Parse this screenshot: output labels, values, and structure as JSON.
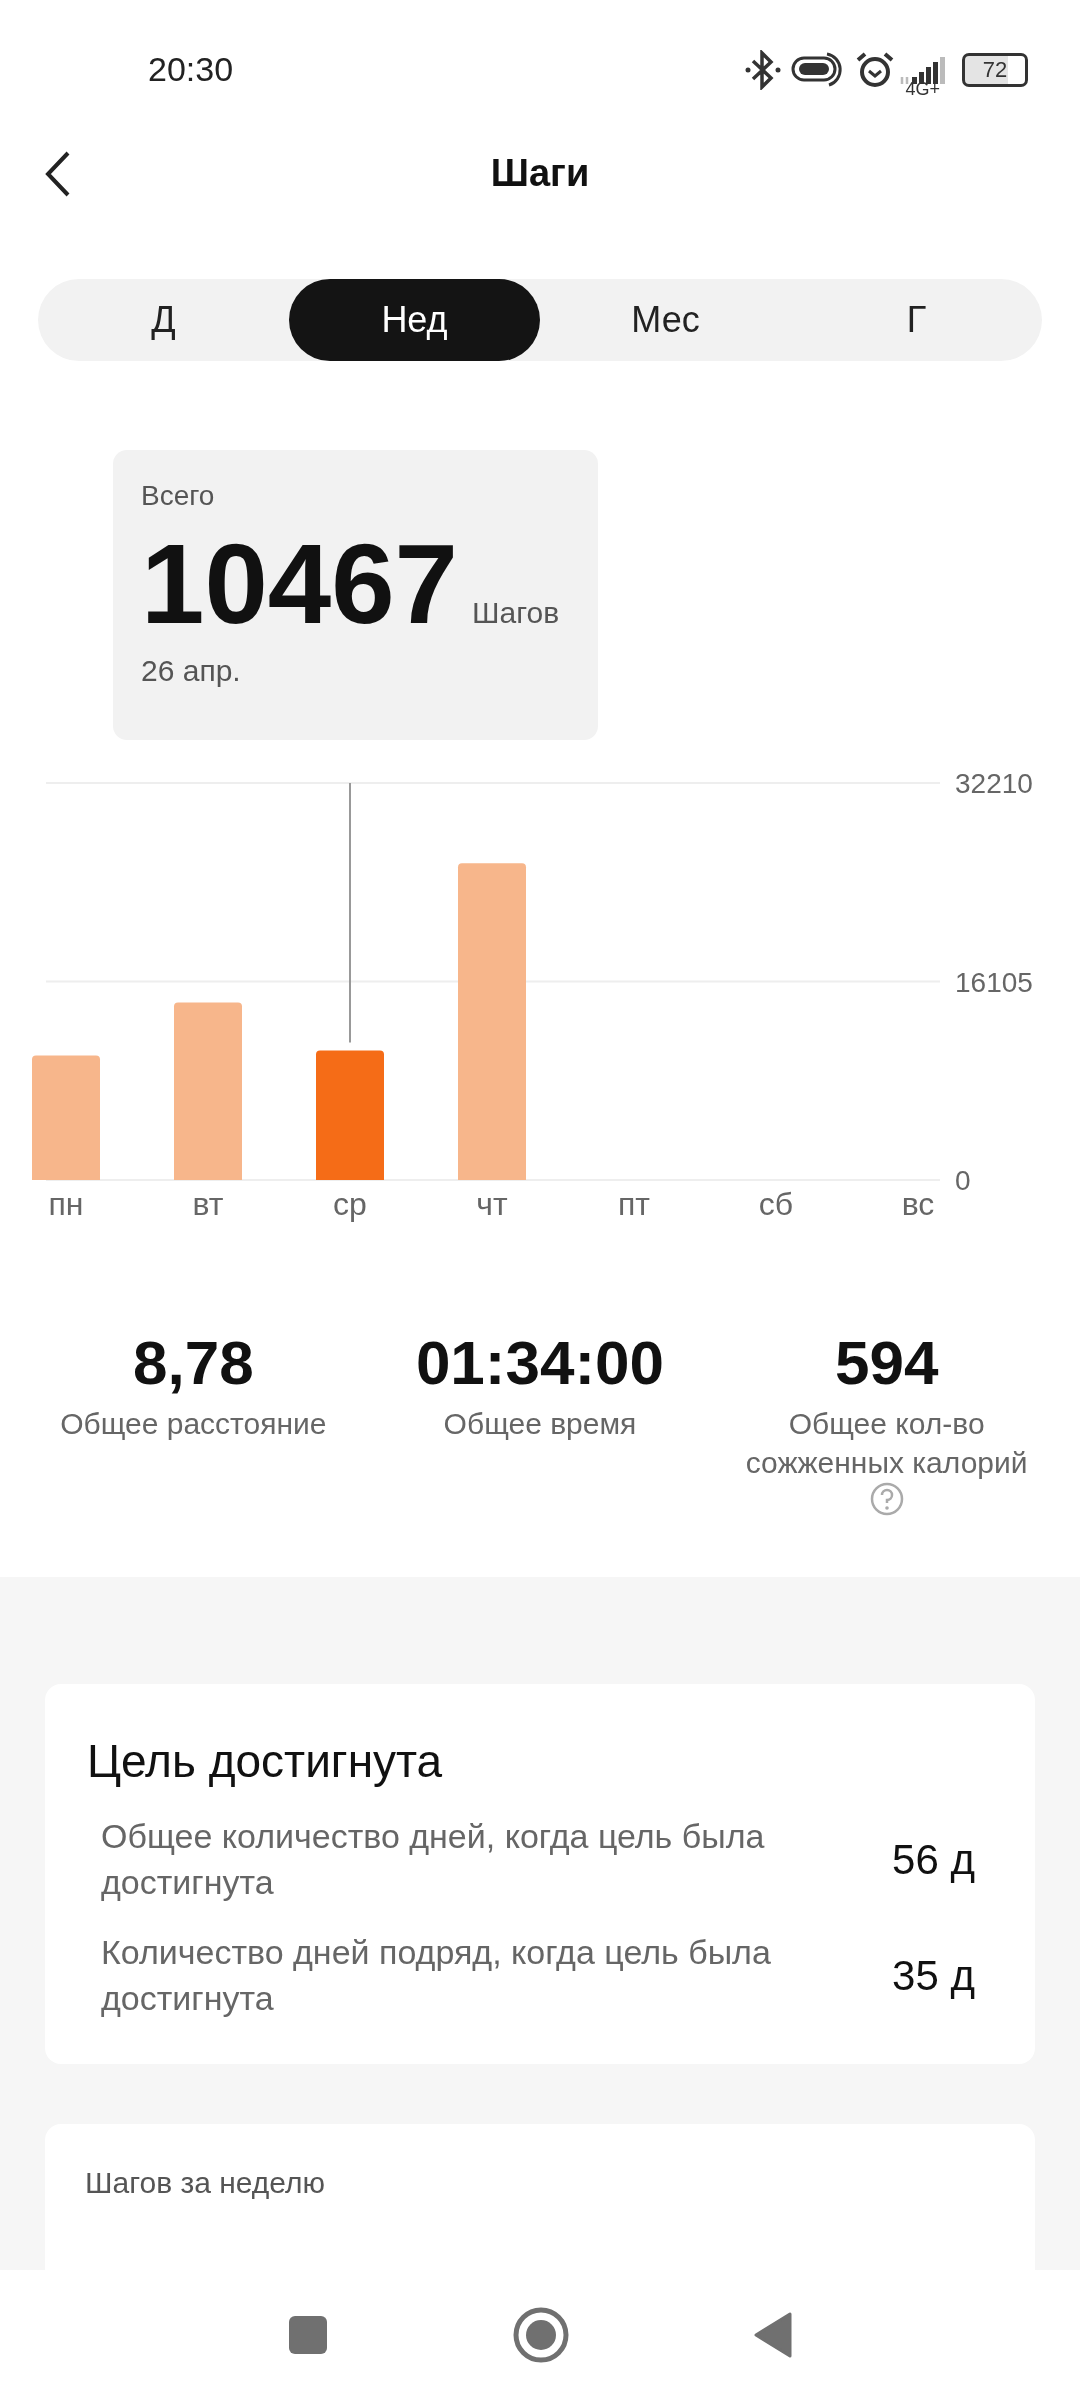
{
  "status_bar": {
    "time": "20:30",
    "network": "4G+",
    "battery": "72"
  },
  "header": {
    "title": "Шаги"
  },
  "tabs": [
    {
      "label": "Д",
      "selected": false
    },
    {
      "label": "Нед",
      "selected": true
    },
    {
      "label": "Мес",
      "selected": false
    },
    {
      "label": "Г",
      "selected": false
    }
  ],
  "tooltip": {
    "label": "Всего",
    "value": "10467",
    "unit": "Шагов",
    "date": "26 апр."
  },
  "chart": {
    "chart_data": {
      "type": "bar",
      "categories": [
        "пн",
        "вт",
        "ср",
        "чт",
        "пт",
        "сб",
        "вс"
      ],
      "series": [
        {
          "color": "#f7b68b",
          "values": [
            10100,
            14400,
            null,
            25700,
            null,
            null,
            null
          ]
        },
        {
          "color": "#f56c17",
          "values": [
            null,
            null,
            10500,
            null,
            null,
            null,
            null
          ]
        }
      ],
      "ylim": [
        0,
        32210
      ],
      "yticks": [
        0,
        16105,
        32210
      ]
    }
  },
  "stats": [
    {
      "value": "8,78",
      "label": "Общее расстояние",
      "help": false
    },
    {
      "value": "01:34:00",
      "label": "Общее время",
      "help": false
    },
    {
      "value": "594",
      "label": "Общее кол-во сожженных калорий",
      "help": true
    }
  ],
  "goal_card": {
    "title": "Цель достигнута",
    "rows": [
      {
        "label": "Общее количество дней, когда цель была достигнута",
        "value": "56 д"
      },
      {
        "label": "Количество дней подряд, когда цель была достигнута",
        "value": "35 д"
      }
    ]
  },
  "weekly_card": {
    "title": "Шагов за неделю"
  }
}
